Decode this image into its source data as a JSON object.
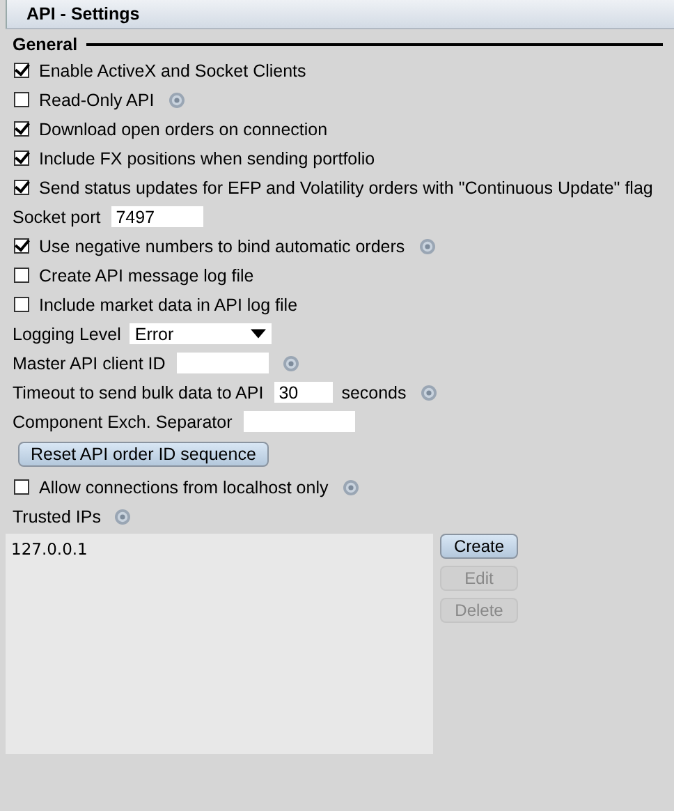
{
  "window": {
    "title": "API - Settings"
  },
  "section": {
    "title": "General"
  },
  "items": [
    {
      "kind": "checkbox",
      "label": "Enable ActiveX and Socket Clients",
      "checked": true,
      "help": false
    },
    {
      "kind": "checkbox",
      "label": "Read-Only API",
      "checked": false,
      "help": true
    },
    {
      "kind": "checkbox",
      "label": "Download open orders on connection",
      "checked": true,
      "help": false
    },
    {
      "kind": "checkbox",
      "label": "Include FX positions when sending portfolio",
      "checked": true,
      "help": false
    },
    {
      "kind": "checkbox",
      "label": "Send status updates for EFP and Volatility orders with \"Continuous Update\" flag",
      "checked": true,
      "help": false
    },
    {
      "kind": "field",
      "label": "Socket port",
      "value": "7497",
      "help": false
    },
    {
      "kind": "checkbox",
      "label": "Use negative numbers to bind automatic orders",
      "checked": true,
      "help": true
    },
    {
      "kind": "checkbox",
      "label": "Create API message log file",
      "checked": false,
      "help": false
    },
    {
      "kind": "checkbox",
      "label": "Include market data in API log file",
      "checked": false,
      "help": false
    },
    {
      "kind": "dropdown",
      "label": "Logging Level",
      "value": "Error",
      "help": false
    },
    {
      "kind": "field",
      "label": "Master API client ID",
      "value": "",
      "help": true
    },
    {
      "kind": "field",
      "label": "Timeout to send bulk data to API",
      "value": "30",
      "suffix": "seconds",
      "help": true
    },
    {
      "kind": "field",
      "label": "Component Exch. Separator",
      "value": "",
      "help": false
    },
    {
      "kind": "button",
      "label": "Reset API order ID sequence"
    },
    {
      "kind": "checkbox",
      "label": "Allow connections from localhost only",
      "checked": false,
      "help": true
    },
    {
      "kind": "heading",
      "label": "Trusted IPs",
      "help": true
    }
  ],
  "trusted_ips": {
    "entries": [
      "127.0.0.1"
    ],
    "buttons": [
      {
        "label": "Create",
        "disabled": false
      },
      {
        "label": "Edit",
        "disabled": true
      },
      {
        "label": "Delete",
        "disabled": true
      }
    ]
  }
}
